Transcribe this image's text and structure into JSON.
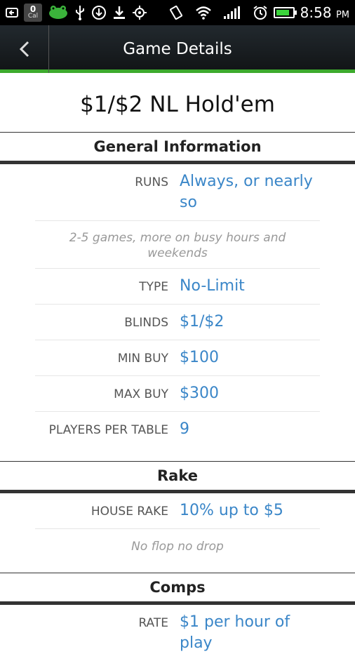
{
  "status_bar": {
    "calendar_badge_count": "0",
    "calendar_badge_label": "Cal",
    "time": "8:58",
    "ampm": "PM"
  },
  "header": {
    "title": "Game Details"
  },
  "game": {
    "title": "$1/$2 NL Hold'em"
  },
  "sections": {
    "general": {
      "title": "General Information",
      "runs_label": "RUNS",
      "runs_value": "Always, or nearly so",
      "runs_note": "2-5 games, more on busy hours and weekends",
      "type_label": "TYPE",
      "type_value": "No-Limit",
      "blinds_label": "BLINDS",
      "blinds_value": "$1/$2",
      "min_buy_label": "MIN BUY",
      "min_buy_value": "$100",
      "max_buy_label": "MAX BUY",
      "max_buy_value": "$300",
      "players_label": "PLAYERS PER TABLE",
      "players_value": "9"
    },
    "rake": {
      "title": "Rake",
      "house_rake_label": "HOUSE RAKE",
      "house_rake_value": "10% up to $5",
      "house_rake_note": "No flop no drop"
    },
    "comps": {
      "title": "Comps",
      "rate_label": "RATE",
      "rate_value": "$1 per hour of play"
    }
  },
  "colors": {
    "accent_green": "#3daa2d",
    "value_blue": "#3a86c8"
  }
}
